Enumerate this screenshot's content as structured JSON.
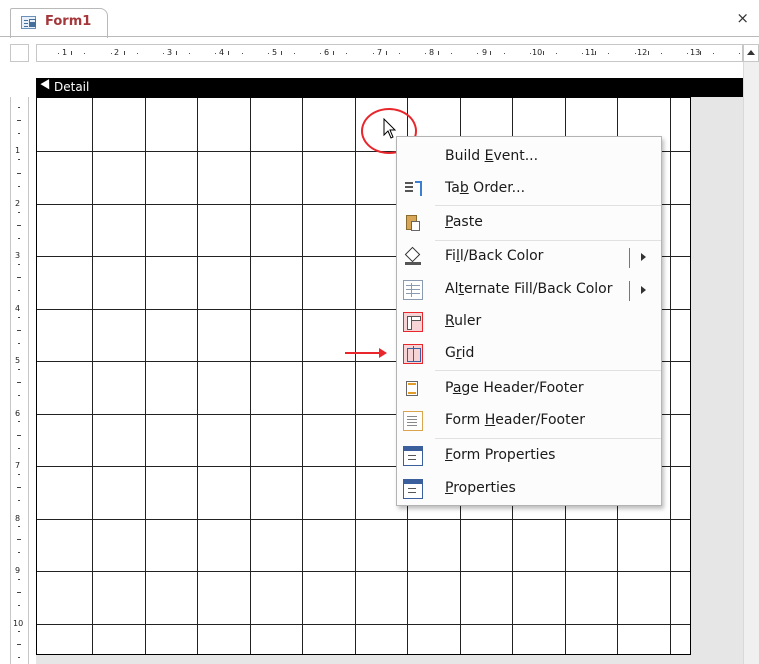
{
  "tab": {
    "title": "Form1",
    "close": "×"
  },
  "ruler": {
    "h_numbers": [
      "1",
      "2",
      "3",
      "4",
      "5",
      "6",
      "7",
      "8",
      "9",
      "10",
      "11",
      "12",
      "13"
    ],
    "v_numbers": [
      "1",
      "2",
      "3",
      "4",
      "5",
      "6",
      "7",
      "8",
      "9",
      "10"
    ]
  },
  "section": {
    "label": "Detail"
  },
  "menu": {
    "items": [
      {
        "label": "Build Event...",
        "icon": "build-event-icon"
      },
      {
        "label": "Tab Order...",
        "icon": "tab-order-icon"
      },
      {
        "label": "Paste",
        "icon": "paste-icon"
      },
      {
        "label": "Fill/Back Color",
        "icon": "fill-color-icon",
        "submenu": true
      },
      {
        "label": "Alternate Fill/Back Color",
        "icon": "alternate-fill-icon",
        "submenu": true
      },
      {
        "label": "Ruler",
        "icon": "ruler-icon",
        "checked": true
      },
      {
        "label": "Grid",
        "icon": "grid-icon",
        "checked": true
      },
      {
        "label": "Page Header/Footer",
        "icon": "page-header-footer-icon"
      },
      {
        "label": "Form Header/Footer",
        "icon": "form-header-footer-icon"
      },
      {
        "label": "Form Properties",
        "icon": "form-properties-icon"
      },
      {
        "label": "Properties",
        "icon": "properties-icon",
        "checked": true
      }
    ]
  },
  "colors": {
    "accent": "#a4373a",
    "annotation": "#e8262b",
    "checked_bg": "#f6d4d6"
  }
}
